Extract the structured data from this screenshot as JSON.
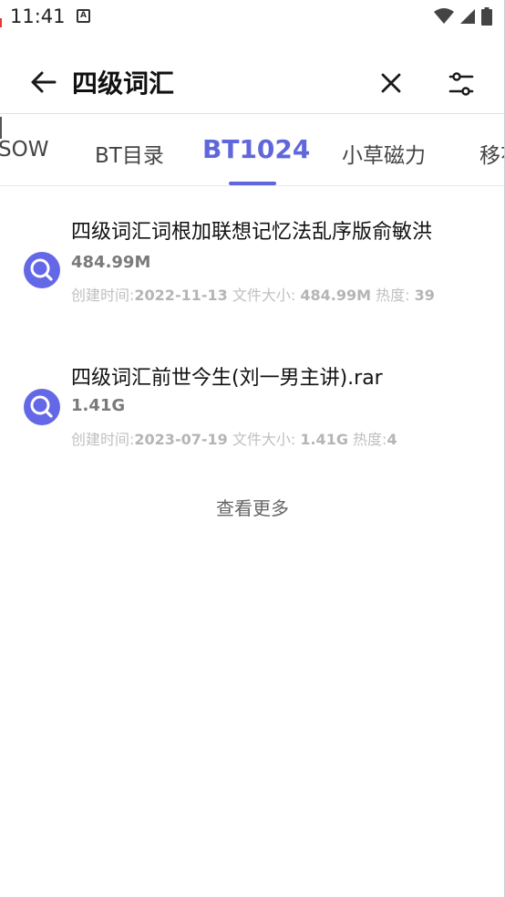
{
  "status_bar": {
    "time": "11:41",
    "badge": "A"
  },
  "toolbar": {
    "title": "四级词汇"
  },
  "tabs": [
    {
      "label": "SOW"
    },
    {
      "label": "BT目录"
    },
    {
      "label": "BT1024"
    },
    {
      "label": "小草磁力"
    },
    {
      "label": "移花"
    }
  ],
  "results": [
    {
      "title": "四级词汇词根加联想记忆法乱序版俞敏洪",
      "size": "484.99M",
      "created_label": "创建时间:",
      "created": "2022-11-13",
      "filesize_label": "文件大小:",
      "filesize": "484.99M",
      "heat_label": "热度:",
      "heat": "39"
    },
    {
      "title": "四级词汇前世今生(刘一男主讲).rar",
      "size": "1.41G",
      "created_label": "创建时间:",
      "created": "2023-07-19",
      "filesize_label": "文件大小:",
      "filesize": "1.41G",
      "heat_label": "热度:",
      "heat": "4"
    }
  ],
  "more_label": "查看更多",
  "colors": {
    "accent": "#6067dc",
    "icon_bg": "#6568e6"
  }
}
